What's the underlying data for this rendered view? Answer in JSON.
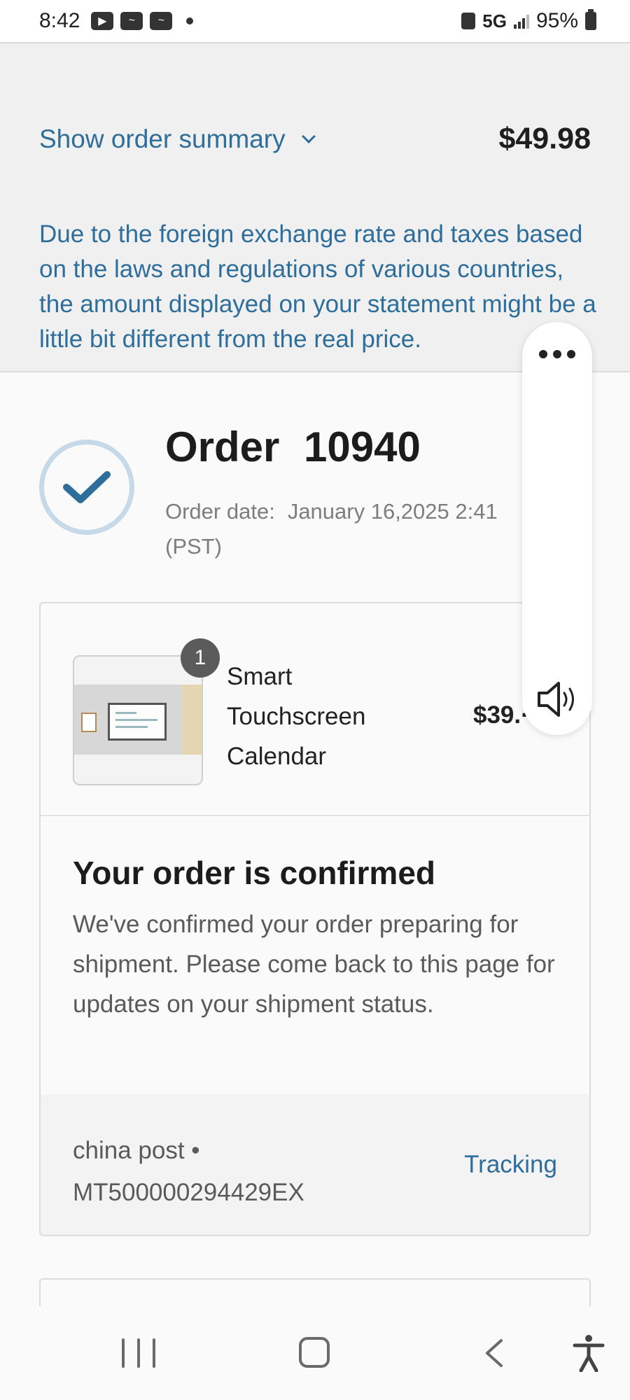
{
  "status_bar": {
    "time": "8:42",
    "app_icons": [
      "youtube-icon",
      "app-icon",
      "app-icon"
    ],
    "network": "5G",
    "battery": "95%"
  },
  "summary": {
    "toggle_label": "Show order summary",
    "total": "$49.98",
    "note": "Due to the foreign exchange rate and taxes based on the laws and regulations of various countries, the amount displayed on your statement might be a little bit different from the real price."
  },
  "order": {
    "title": "Order 10940",
    "date_label": "Order date:",
    "date_value": "January 16,2025 2:41 (PST)"
  },
  "product": {
    "quantity": "1",
    "name": "Smart Touchscreen Calendar",
    "price": "$39.·"
  },
  "confirmation": {
    "title": "Your order is confirmed",
    "text": "We've confirmed your order preparing for shipment. Please come back to this page for updates on your shipment status."
  },
  "shipment": {
    "carrier": "china post •",
    "tracking_number": "MT500000294429EX",
    "tracking_label": "Tracking"
  },
  "colors": {
    "link": "#2d6e9b",
    "summary_bg": "#f0f0f0",
    "check": "#2d6e9b"
  }
}
